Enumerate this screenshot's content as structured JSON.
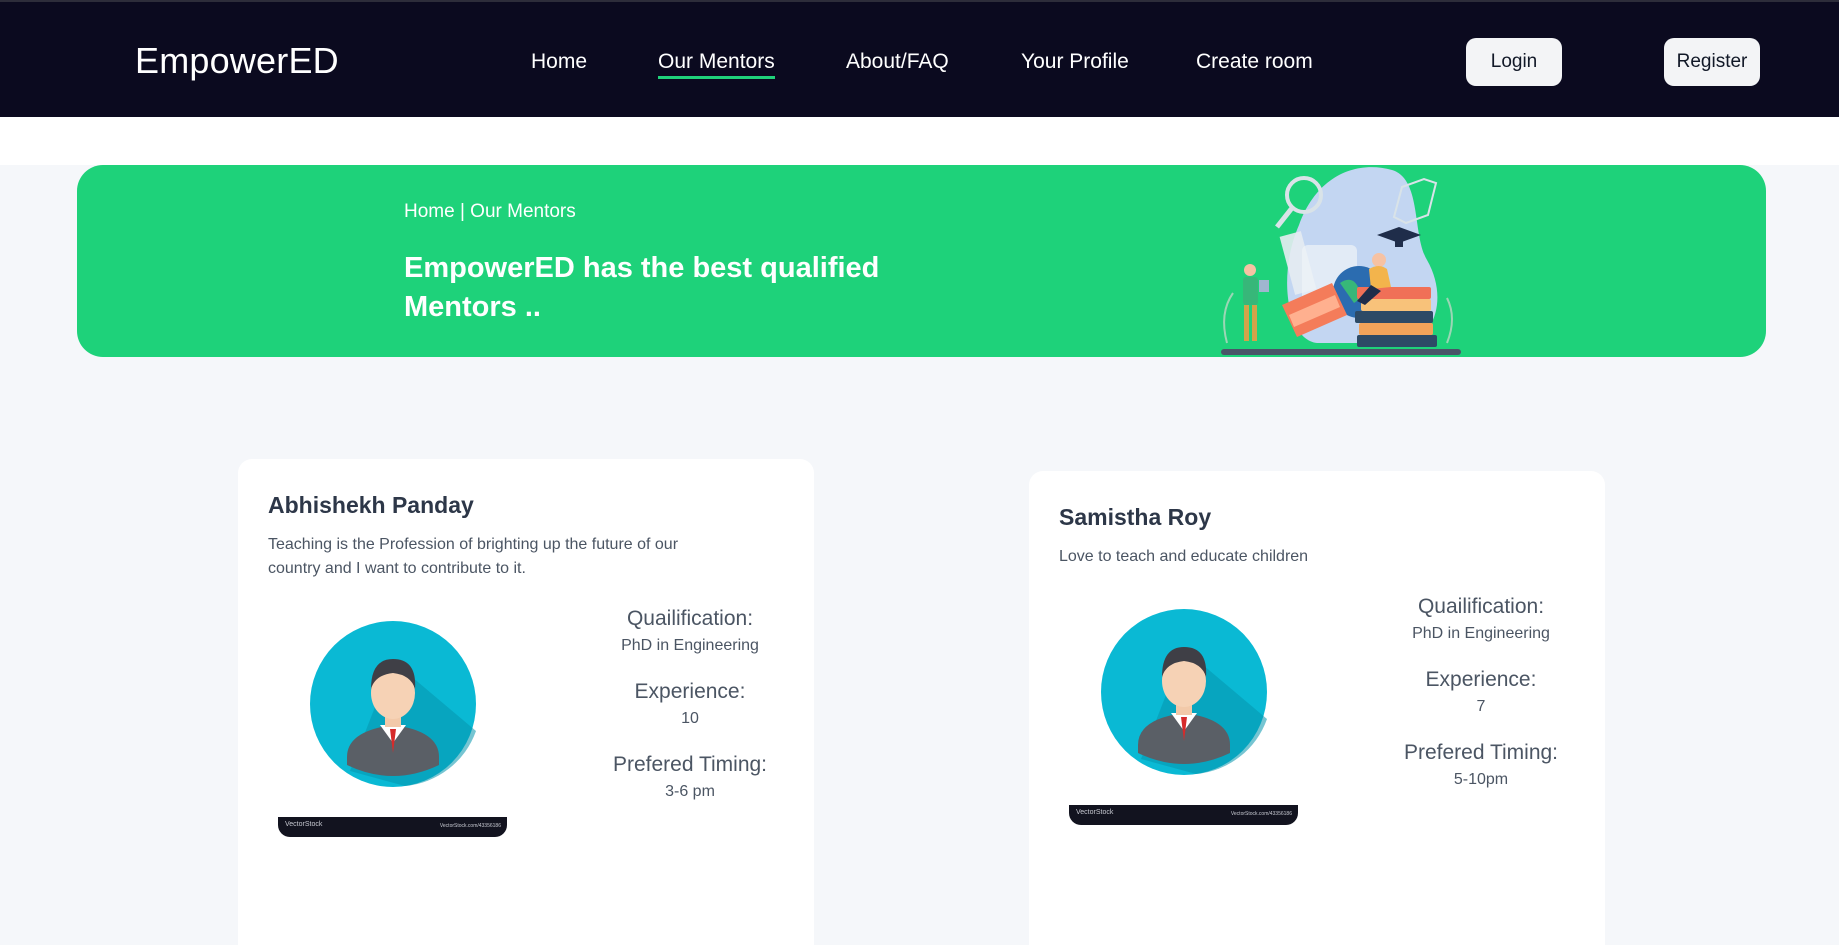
{
  "navbar": {
    "brand": "EmpowerED",
    "links": [
      "Home",
      "Our Mentors",
      "About/FAQ",
      "Your Profile",
      "Create room"
    ],
    "login_label": "Login",
    "register_label": "Register",
    "active_link": "Our Mentors",
    "accent_color": "#1fd27a"
  },
  "hero": {
    "breadcrumb": "Home | Our Mentors",
    "title": "EmpowerED has the best qualified Mentors ..",
    "background": "#1ed27a"
  },
  "mentors": [
    {
      "name": "Abhishekh Panday",
      "bio": "Teaching is the Profession of brighting up the future of our country and I want to contribute to it.",
      "qualification_label": "Quailification:",
      "qualification": "PhD in Engineering",
      "experience_label": "Experience:",
      "experience": "10",
      "timing_label": "Prefered Timing:",
      "timing": "3-6 pm",
      "stock_left": "VectorStock",
      "stock_right": "VectorStock.com/43356186"
    },
    {
      "name": "Samistha Roy",
      "bio": "Love to teach and educate children",
      "qualification_label": "Quailification:",
      "qualification": "PhD in Engineering",
      "experience_label": "Experience:",
      "experience": "7",
      "timing_label": "Prefered Timing:",
      "timing": "5-10pm",
      "stock_left": "VectorStock",
      "stock_right": "VectorStock.com/43356186"
    }
  ]
}
